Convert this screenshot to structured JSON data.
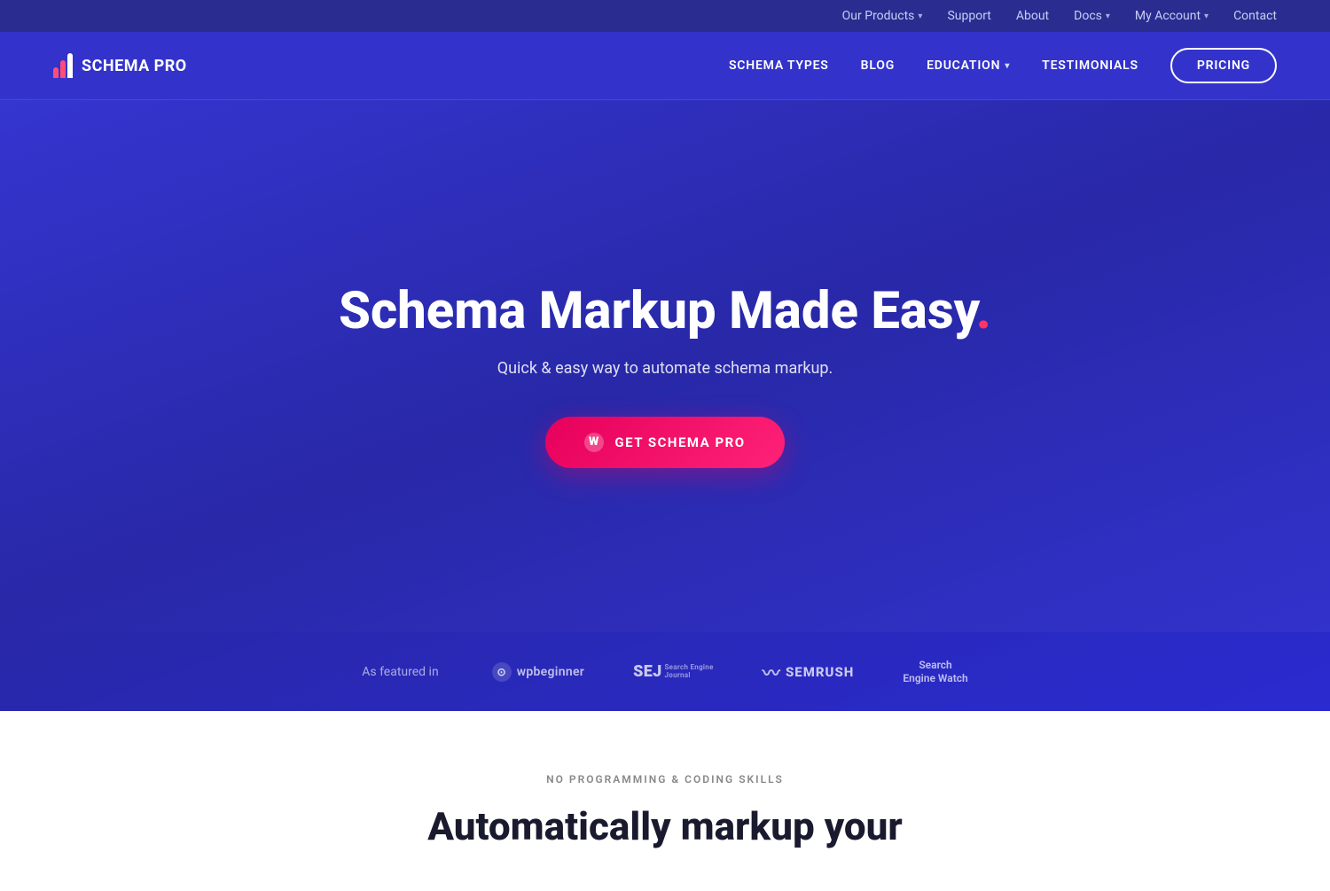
{
  "topbar": {
    "links": [
      {
        "label": "Our Products",
        "has_dropdown": true
      },
      {
        "label": "Support",
        "has_dropdown": false
      },
      {
        "label": "About",
        "has_dropdown": false
      },
      {
        "label": "Docs",
        "has_dropdown": true
      },
      {
        "label": "My Account",
        "has_dropdown": true
      },
      {
        "label": "Contact",
        "has_dropdown": false
      }
    ]
  },
  "nav": {
    "logo_text": "SCHEMA PRO",
    "links": [
      {
        "label": "SCHEMA TYPES",
        "has_dropdown": false
      },
      {
        "label": "BLOG",
        "has_dropdown": false
      },
      {
        "label": "EDUCATION",
        "has_dropdown": true
      },
      {
        "label": "TESTIMONIALS",
        "has_dropdown": false
      }
    ],
    "pricing_label": "PRICING"
  },
  "hero": {
    "heading_main": "Schema Markup Made Easy",
    "heading_dot": ".",
    "subheading": "Quick & easy way to automate schema markup.",
    "cta_label": "GET SCHEMA PRO",
    "wp_icon": "W"
  },
  "featured": {
    "label": "As featured in",
    "logos": [
      {
        "name": "wpbeginner",
        "display": "wpbeginner"
      },
      {
        "name": "sej",
        "display": "SEJ Search Engine Journal"
      },
      {
        "name": "semrush",
        "display": "SEMRUSH"
      },
      {
        "name": "sew",
        "display": "Search Engine Watch"
      }
    ]
  },
  "bottom_section": {
    "label": "NO PROGRAMMING & CODING SKILLS",
    "heading": "Automatically markup your"
  }
}
